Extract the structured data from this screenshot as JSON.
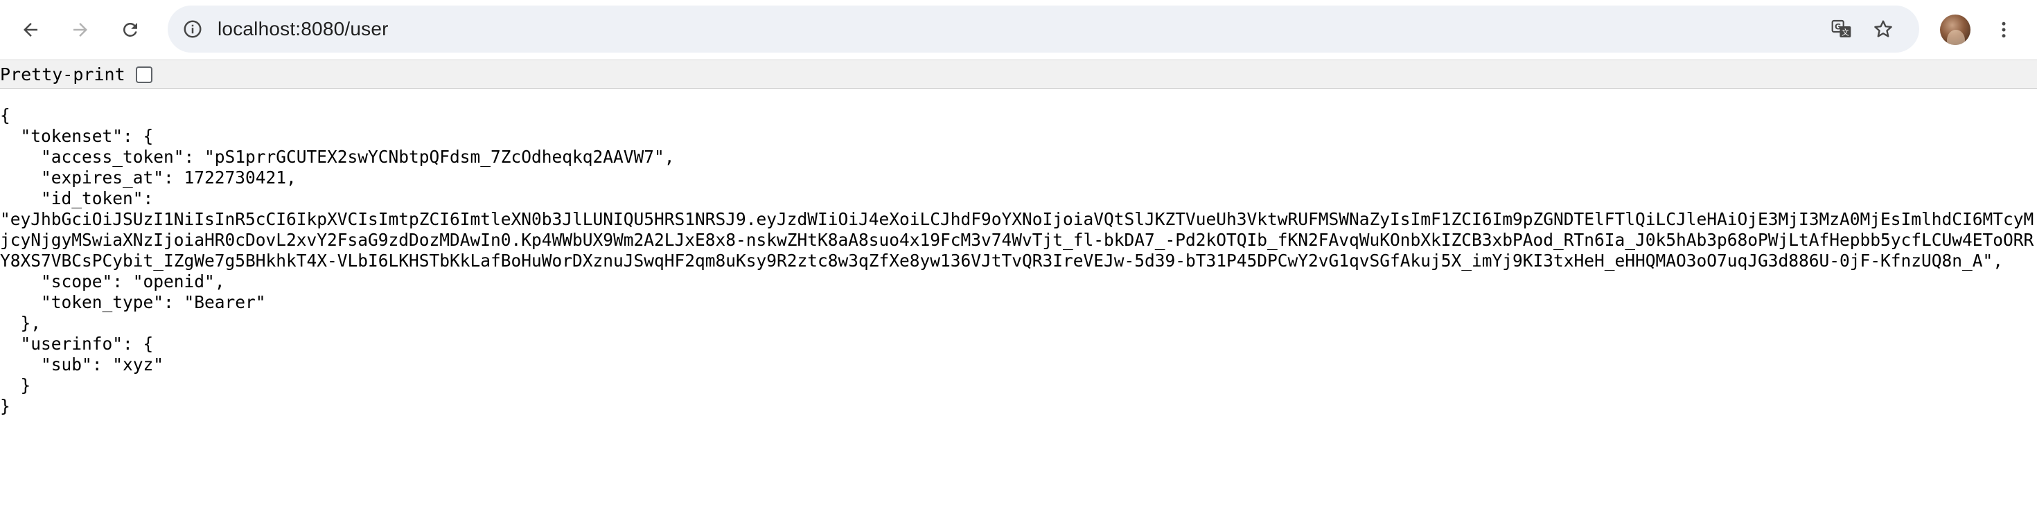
{
  "browser": {
    "url": "localhost:8080/user",
    "icons": {
      "back": "arrow-left-icon",
      "forward": "arrow-right-icon",
      "reload": "reload-icon",
      "site_info": "info-icon",
      "translate": "translate-icon",
      "bookmark": "star-icon",
      "menu": "kebab-menu-icon"
    }
  },
  "viewer": {
    "pretty_print_label": "Pretty-print",
    "pretty_print_checked": false
  },
  "json_lines": [
    "{",
    "  \"tokenset\": {",
    "    \"access_token\": \"pS1prrGCUTEX2swYCNbtpQFdsm_7ZcOdheqkq2AAVW7\",",
    "    \"expires_at\": 1722730421,",
    "    \"id_token\":",
    "\"eyJhbGciOiJSUzI1NiIsInR5cCI6IkpXVCIsImtpZCI6ImtleXN0b3JlLUNIQU5HRS1NRSJ9.eyJzdWIiOiJ4eXoiLCJhdF9oYXNoIjoiaVQtSlJKZTVueUh3VktwRUFMSWNaZyIsImF1ZCI6Im9pZGNDTElFTlQiLCJleHAiOjE3MjI3MzA0MjEsImlhdCI6MTcyMjcyNjgyMSwiaXNzIjoiaHR0cDovL2xvY2FsaG9zdDozMDAwIn0.Kp4WWbUX9Wm2A2LJxE8x8-nskwZHtK8aA8suo4x19FcM3v74WvTjt_fl-bkDA7_-Pd2kOTQIb_fKN2FAvqWuKOnbXkIZCB3xbPAod_RTn6Ia_J0k5hAb3p68oPWjLtAfHepbb5ycfLCUw4EToORRY8XS7VBCsPCybit_IZgWe7g5BHkhkT4X-VLbI6LKHSTbKkLafBoHuWorDXznuJSwqHF2qm8uKsy9R2ztc8w3qZfXe8yw136VJtTvQR3IreVEJw-5d39-bT31P45DPCwY2vG1qvSGfAkuj5X_imYj9KI3txHeH_eHHQMAO3oO7uqJG3d886U-0jF-KfnzUQ8n_A\",",
    "    \"scope\": \"openid\",",
    "    \"token_type\": \"Bearer\"",
    "  },",
    "  \"userinfo\": {",
    "    \"sub\": \"xyz\"",
    "  }",
    "}"
  ]
}
